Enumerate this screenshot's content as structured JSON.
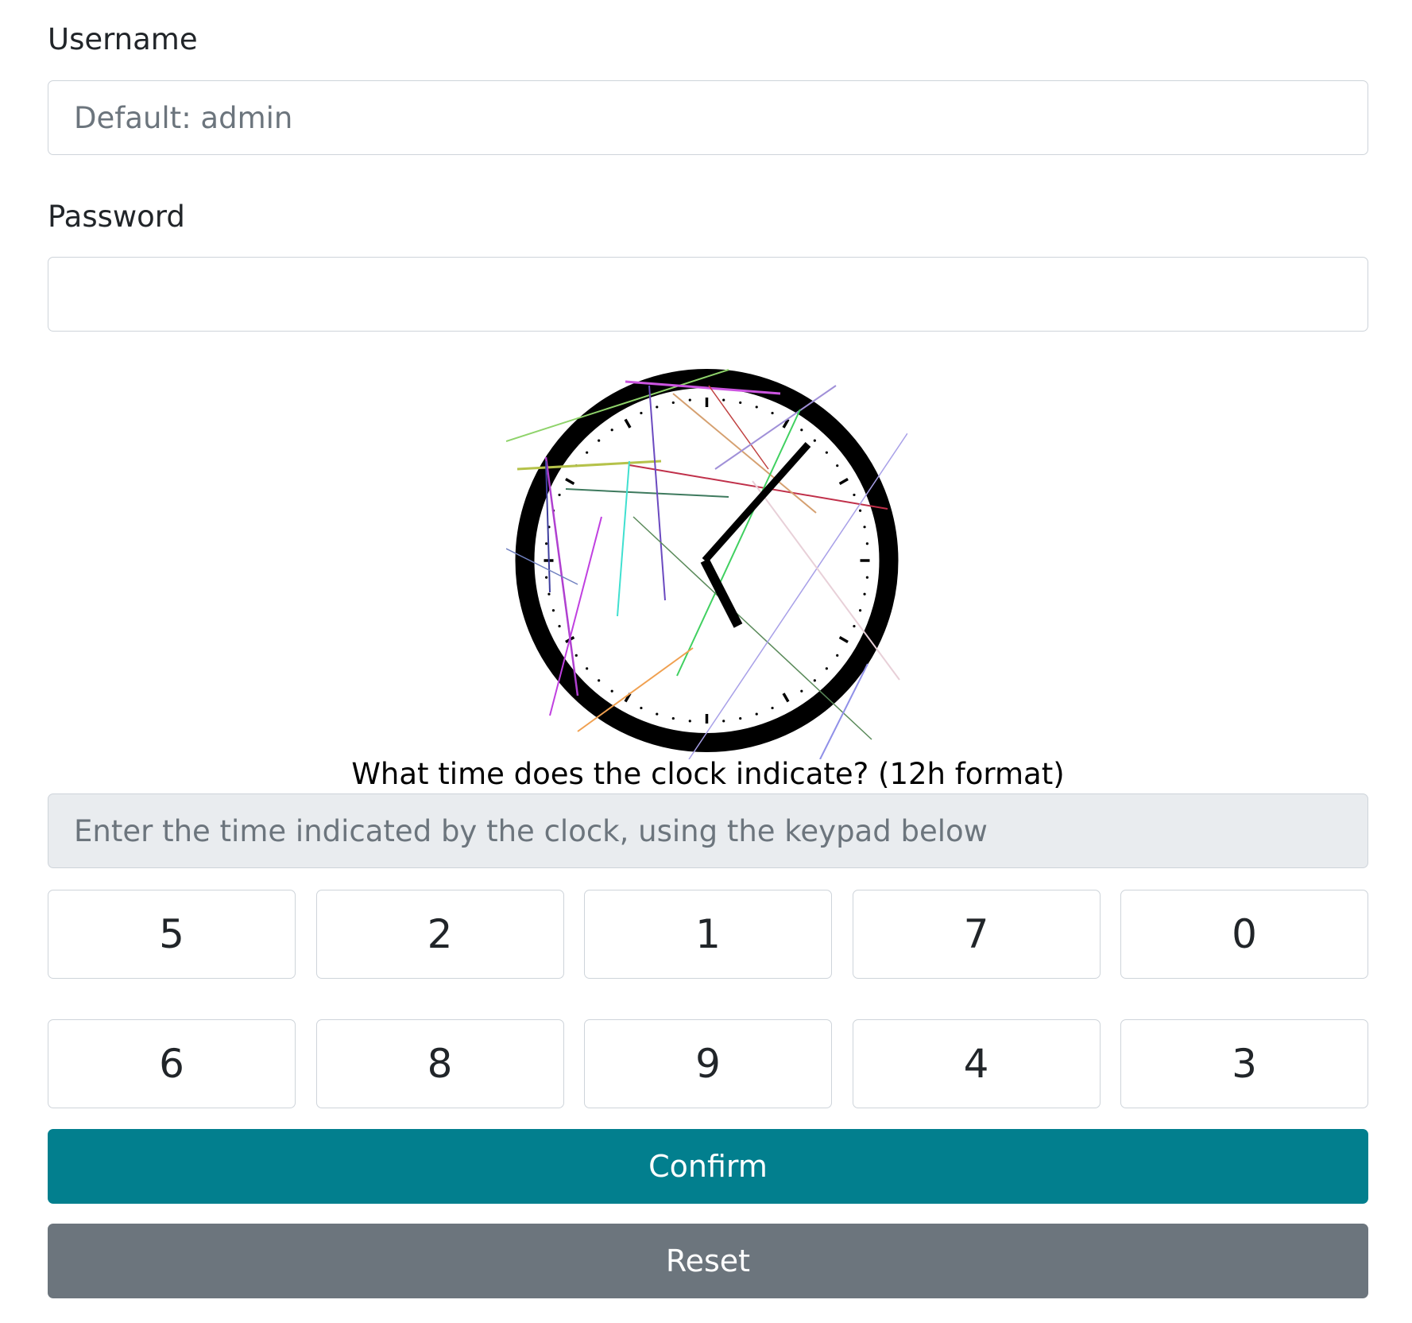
{
  "form": {
    "username_label": "Username",
    "username_placeholder": "Default: admin",
    "username_value": "",
    "password_label": "Password",
    "password_value": ""
  },
  "captcha": {
    "question": "What time does the clock indicate? (12h format)",
    "answer_placeholder": "Enter the time indicated by the clock, using the keypad below",
    "answer_value": "",
    "keypad_keys": [
      "5",
      "2",
      "1",
      "7",
      "0",
      "6",
      "8",
      "9",
      "4",
      "3"
    ]
  },
  "buttons": {
    "confirm_label": "Confirm",
    "reset_label": "Reset"
  },
  "colors": {
    "confirm_bg": "#027f8e",
    "reset_bg": "#6c757d"
  }
}
